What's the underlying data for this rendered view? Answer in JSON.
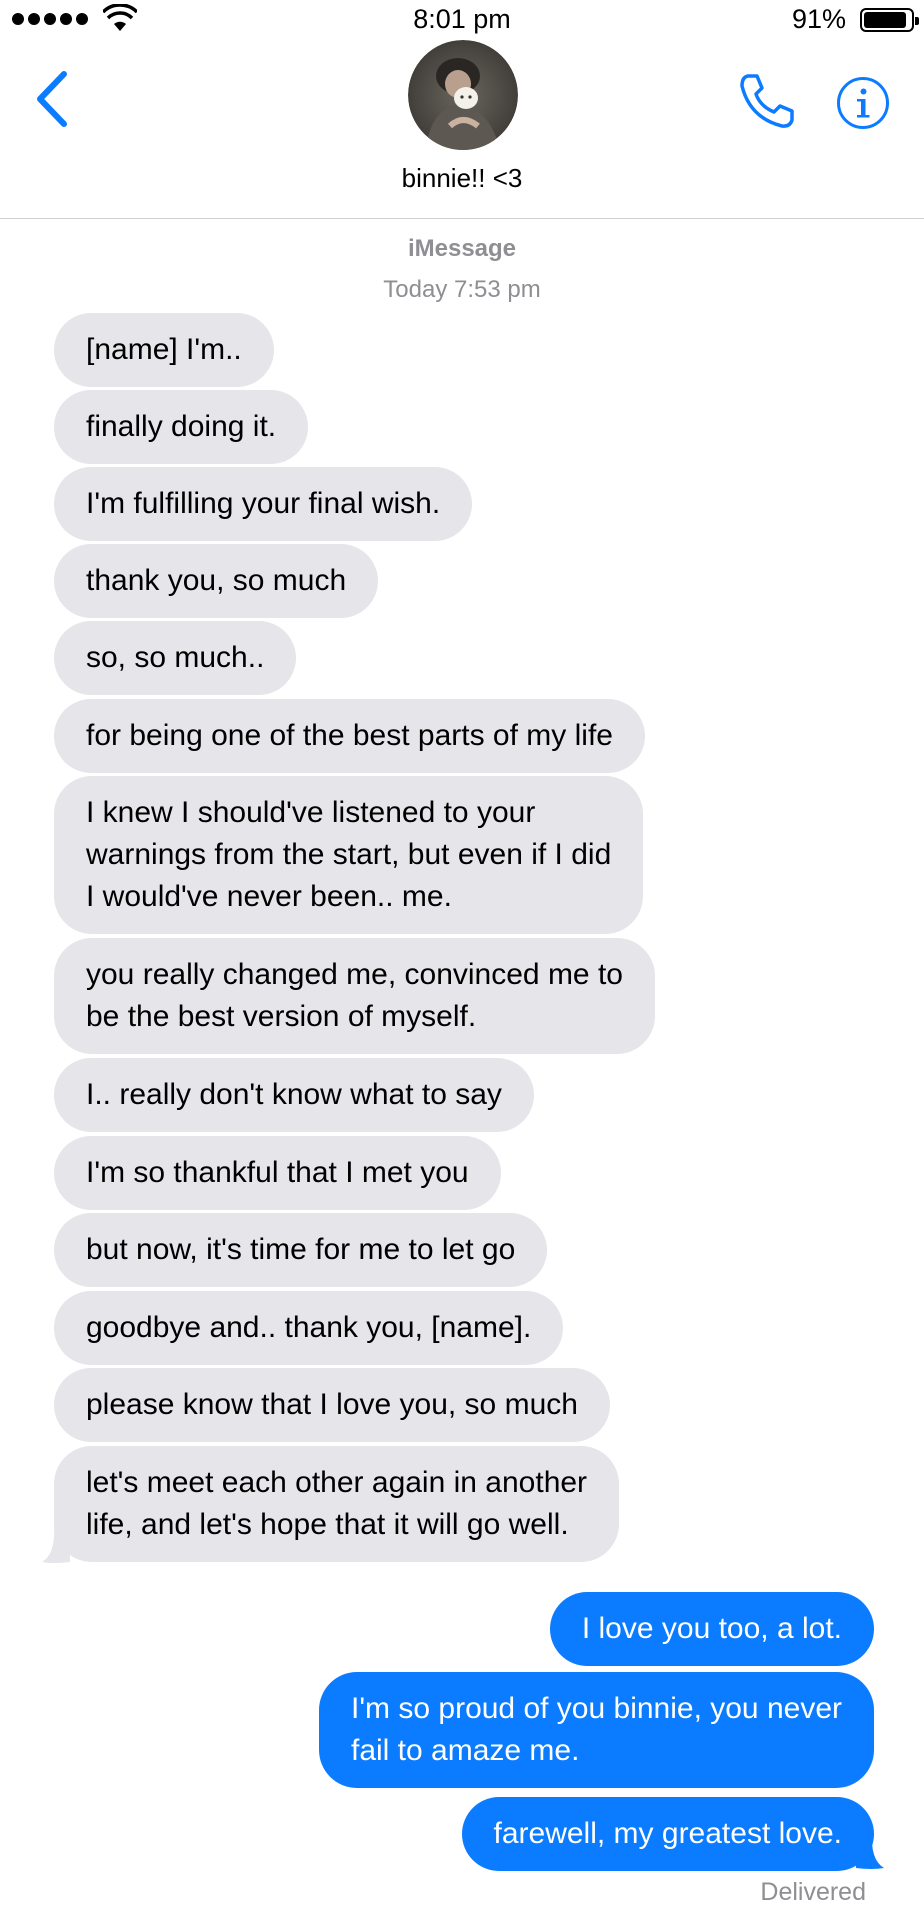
{
  "status_bar": {
    "time": "8:01 pm",
    "battery_percent": "91%",
    "battery_level": 0.91,
    "signal_bars": 5
  },
  "header": {
    "contact_name": "binnie!! <3",
    "back_icon": "chevron-left-icon",
    "call_icon": "phone-icon",
    "info_icon": "info-icon"
  },
  "thread": {
    "service": "iMessage",
    "timestamp": "Today 7:53 pm"
  },
  "messages": [
    {
      "from": "them",
      "text": "[name] I'm.."
    },
    {
      "from": "them",
      "text": "finally doing it."
    },
    {
      "from": "them",
      "text": "I'm fulfilling your final wish."
    },
    {
      "from": "them",
      "text": "thank you, so much"
    },
    {
      "from": "them",
      "text": "so, so much.."
    },
    {
      "from": "them",
      "text": "for being one of the best parts of my life"
    },
    {
      "from": "them",
      "text": "I knew I should've listened to your\nwarnings from the start, but even if I did\nI would've never been.. me."
    },
    {
      "from": "them",
      "text": "you really changed me, convinced me to\nbe the best version of myself."
    },
    {
      "from": "them",
      "text": "I.. really don't know what to say"
    },
    {
      "from": "them",
      "text": "I'm so thankful that I met you"
    },
    {
      "from": "them",
      "text": "but now, it's time for me to let go"
    },
    {
      "from": "them",
      "text": "goodbye and.. thank you, [name]."
    },
    {
      "from": "them",
      "text": "please know that I love you, so much"
    },
    {
      "from": "them",
      "text": "let's meet each other again in another\nlife, and let's hope that it will go well."
    },
    {
      "from": "me",
      "text": "I love you too, a lot."
    },
    {
      "from": "me",
      "text": "I'm so proud of you binnie, you never\nfail to amaze me."
    },
    {
      "from": "me",
      "text": "farewell, my greatest love."
    }
  ],
  "delivery_status": "Delivered",
  "colors": {
    "accent": "#0b7cff",
    "incoming_bubble": "#e5e5ea",
    "meta_text": "#8e8e93"
  }
}
